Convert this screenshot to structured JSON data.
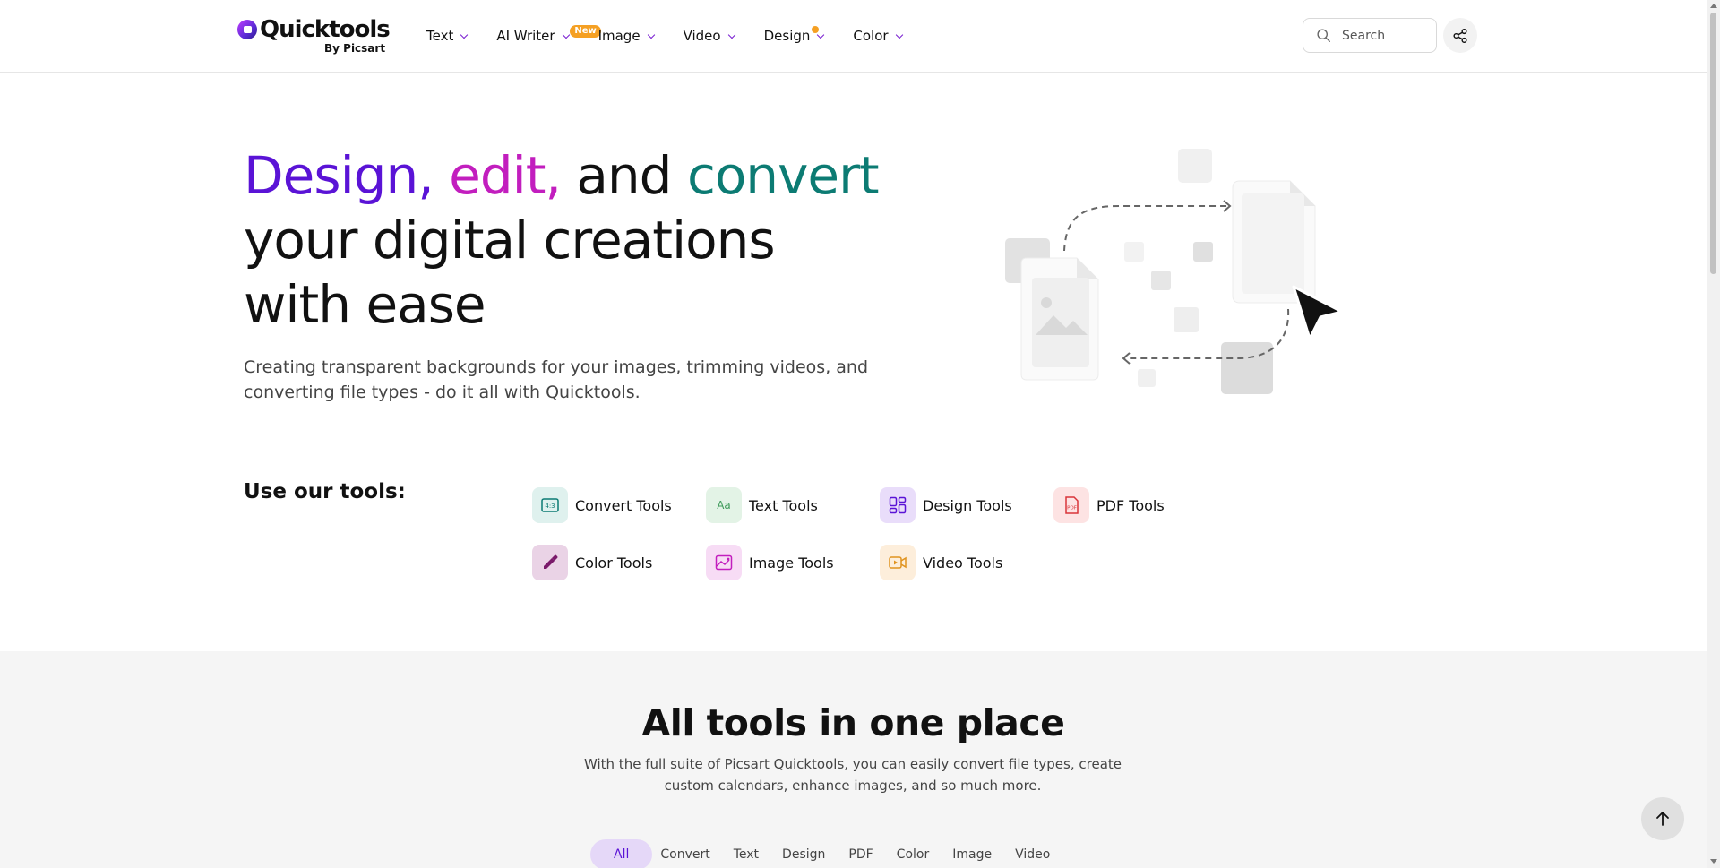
{
  "header": {
    "logo_name": "Quicktools",
    "logo_sub": "By Picsart",
    "nav": [
      {
        "label": "Text"
      },
      {
        "label": "AI Writer",
        "badge": "New"
      },
      {
        "label": "Image"
      },
      {
        "label": "Video"
      },
      {
        "label": "Design",
        "dot": true
      },
      {
        "label": "Color"
      }
    ],
    "search_placeholder": "Search",
    "share_icon": "share-icon"
  },
  "hero": {
    "title_part1": "Design,",
    "title_part2": "edit,",
    "title_part3": "and",
    "title_part4": "convert",
    "title_rest1": "your digital creations",
    "title_rest2": "with ease",
    "description": "Creating transparent backgrounds for your images, trimming videos, and converting file types - do it all with Quicktools."
  },
  "tools": {
    "label": "Use our tools:",
    "items": [
      {
        "label": "Convert Tools",
        "icon": "convert-icon",
        "color": "#0c7b73",
        "bg": "#dff1ee"
      },
      {
        "label": "Text Tools",
        "icon": "text-icon",
        "color": "#3e9a5a",
        "bg": "#e3f3e6"
      },
      {
        "label": "Design Tools",
        "icon": "design-icon",
        "color": "#5a13d6",
        "bg": "#e9ddfa"
      },
      {
        "label": "PDF Tools",
        "icon": "pdf-icon",
        "color": "#d9343a",
        "bg": "#fde3e3"
      },
      {
        "label": "Color Tools",
        "icon": "color-picker-icon",
        "color": "#7a1a6a",
        "bg": "#ead3e6"
      },
      {
        "label": "Image Tools",
        "icon": "image-icon",
        "color": "#c21ebe",
        "bg": "#f7dcf5"
      },
      {
        "label": "Video Tools",
        "icon": "video-icon",
        "color": "#e0931f",
        "bg": "#fdeedb"
      }
    ]
  },
  "all_tools": {
    "title": "All tools in one place",
    "description": "With the full suite of Picsart Quicktools, you can easily convert file types, create custom calendars, enhance images, and so much more.",
    "filters": [
      "All",
      "Convert",
      "Text",
      "Design",
      "PDF",
      "Color",
      "Image",
      "Video"
    ],
    "active_filter": "All"
  },
  "back_to_top_icon": "arrow-up-icon",
  "colors": {
    "accent_purple": "#5a13d6",
    "accent_magenta": "#c21ebe",
    "accent_teal": "#0c7b73",
    "badge_orange": "#f5a023"
  }
}
